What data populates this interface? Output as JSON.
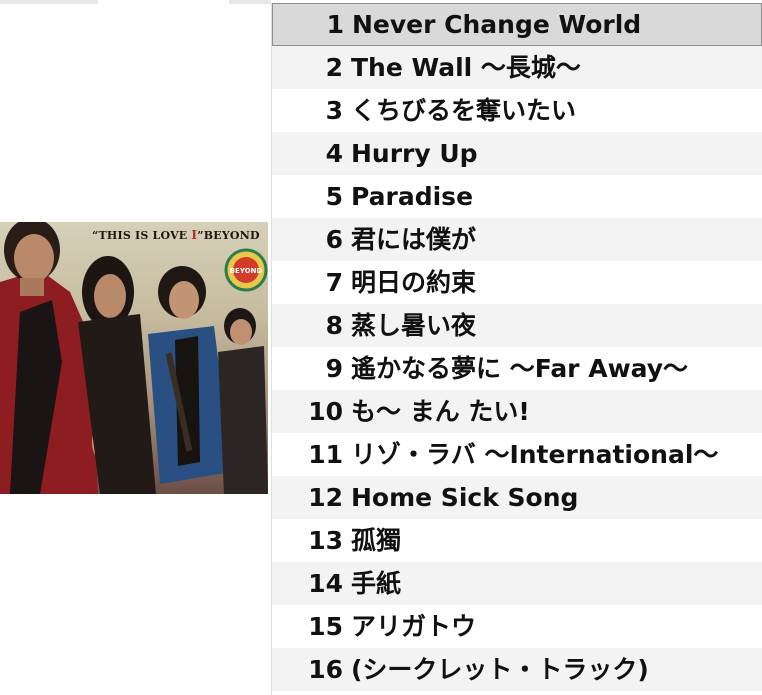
{
  "cover": {
    "title_prefix": "“THIS IS LOVE ",
    "title_roman": "I",
    "title_suffix": "”BEYOND",
    "badge_text": "BEYOND"
  },
  "tracks": [
    {
      "num": "1",
      "title": "Never Change World",
      "selected": true
    },
    {
      "num": "2",
      "title": "The Wall ～長城～",
      "selected": false
    },
    {
      "num": "3",
      "title": "くちびるを奪いたい",
      "selected": false
    },
    {
      "num": "4",
      "title": "Hurry Up",
      "selected": false
    },
    {
      "num": "5",
      "title": "Paradise",
      "selected": false
    },
    {
      "num": "6",
      "title": "君には僕が",
      "selected": false
    },
    {
      "num": "7",
      "title": "明日の約束",
      "selected": false
    },
    {
      "num": "8",
      "title": "蒸し暑い夜",
      "selected": false
    },
    {
      "num": "9",
      "title": "遙かなる夢に ～Far Away～",
      "selected": false
    },
    {
      "num": "10",
      "title": "も～ まん たい!",
      "selected": false
    },
    {
      "num": "11",
      "title": "リゾ・ラバ ～International～",
      "selected": false
    },
    {
      "num": "12",
      "title": "Home Sick Song",
      "selected": false
    },
    {
      "num": "13",
      "title": "孤獨",
      "selected": false
    },
    {
      "num": "14",
      "title": "手紙",
      "selected": false
    },
    {
      "num": "15",
      "title": "アリガトウ",
      "selected": false
    },
    {
      "num": "16",
      "title": "(シークレット・トラック)",
      "selected": false
    }
  ],
  "colors": {
    "selected_row": "#d9d9d9",
    "alt_row": "#f3f3f3",
    "text": "#111111"
  }
}
